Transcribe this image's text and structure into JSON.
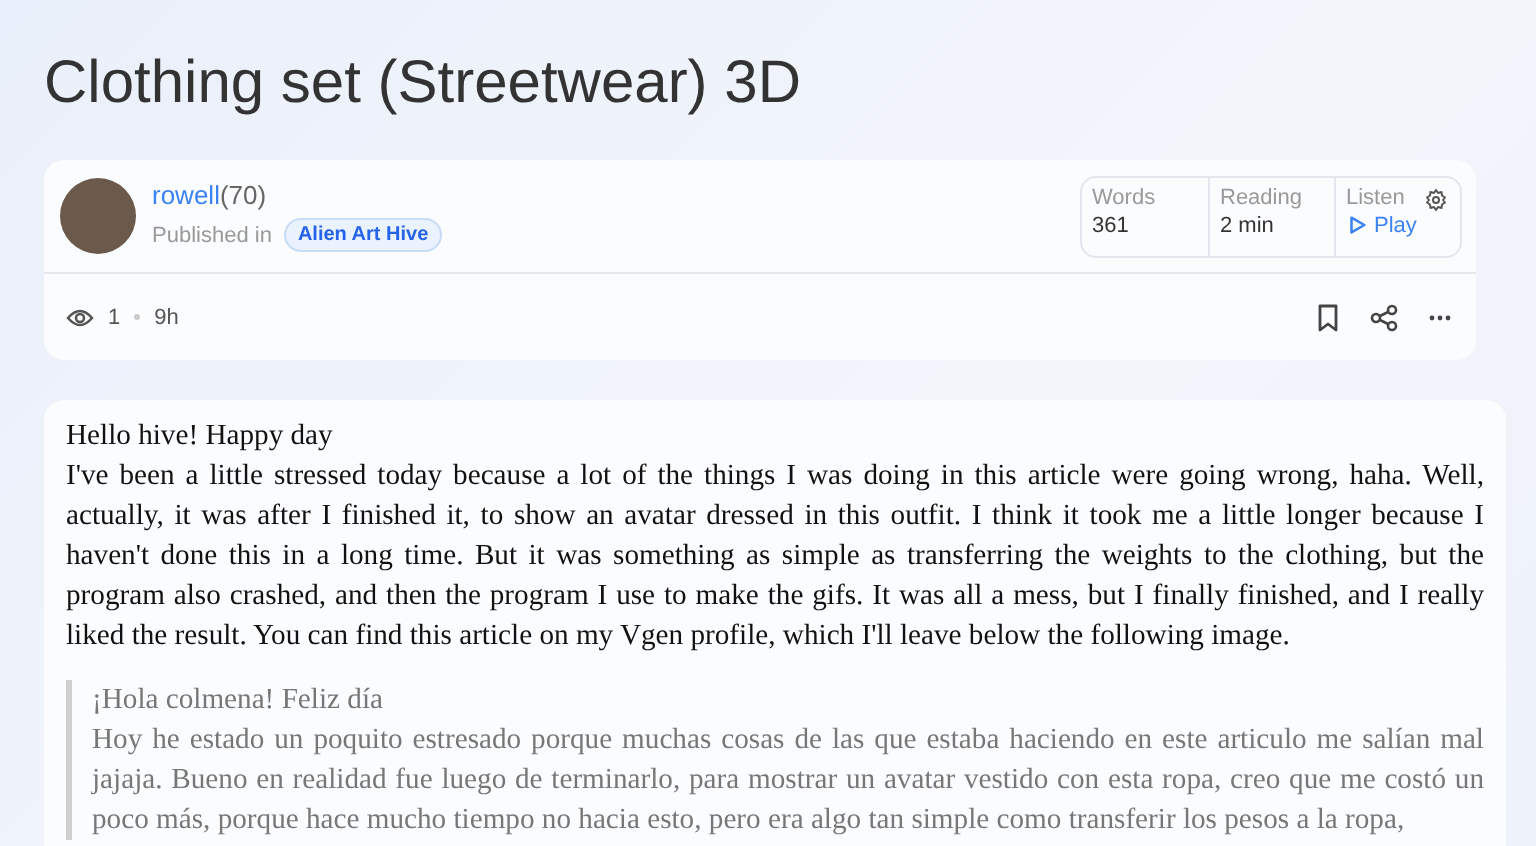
{
  "title": "Clothing set (Streetwear) 3D",
  "author": {
    "name": "rowell",
    "reputation": "(70)",
    "published_in": "Published in",
    "community": "Alien Art Hive"
  },
  "stats": [
    {
      "label": "Words",
      "value": "361",
      "kind": "text"
    },
    {
      "label": "Reading",
      "value": "2 min",
      "kind": "text"
    },
    {
      "label": "Listen",
      "value": "Play",
      "kind": "play"
    }
  ],
  "meta": {
    "views": "1",
    "age": "9h"
  },
  "body": {
    "greeting": "Hello hive! Happy day",
    "paragraph": "I've been a little stressed today because a lot of the things I was doing in this article were going wrong, haha. Well, actually, it was after I finished it, to show an avatar dressed in this outfit. I think it took me a little longer because I haven't done this in a long time. But it was something as simple as transferring the weights to the clothing, but the program also crashed, and then the program I use to make the gifs. It was all a mess, but I finally finished, and I really liked the result. You can find this article on my Vgen profile, which I'll leave below the following image.",
    "quote_greeting": "¡Hola colmena! Feliz día",
    "quote": "Hoy he estado un poquito estresado porque muchas cosas de las que estaba haciendo en este articulo me salían mal jajaja. Bueno en realidad fue luego de terminarlo, para mostrar un avatar vestido con esta ropa, creo que me costó un poco más, porque hace mucho tiempo no hacia esto, pero era algo tan simple como transferir los pesos a la ropa,"
  }
}
